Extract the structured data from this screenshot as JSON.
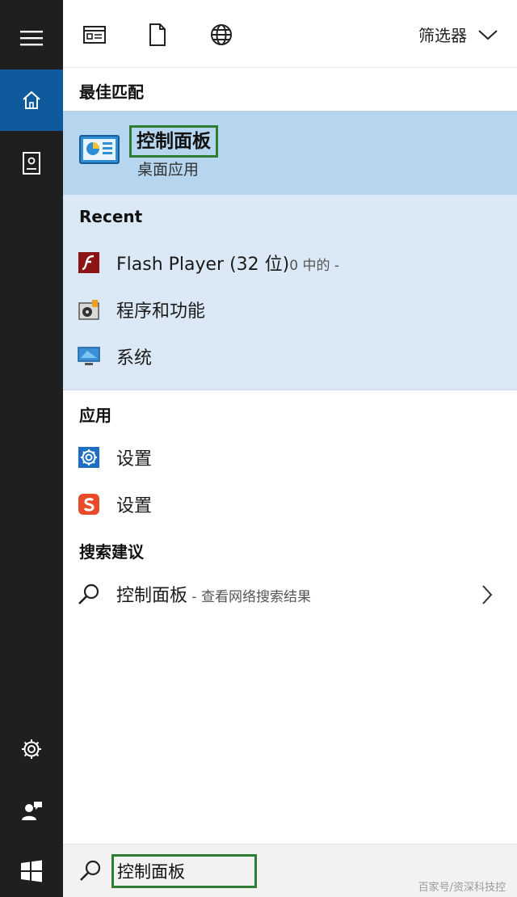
{
  "toolbar": {
    "filter_label": "筛选器"
  },
  "sections": {
    "best_match": "最佳匹配",
    "recent": "Recent",
    "apps": "应用",
    "suggestions": "搜索建议"
  },
  "best_match": {
    "title": "控制面板",
    "subtitle": "桌面应用"
  },
  "recent": [
    {
      "label": "Flash Player (32 位)",
      "detail": "0 中的 -"
    },
    {
      "label": "程序和功能",
      "detail": ""
    },
    {
      "label": "系统",
      "detail": ""
    }
  ],
  "apps": [
    {
      "label": "设置"
    },
    {
      "label": "设置"
    }
  ],
  "suggestion": {
    "label": "控制面板",
    "detail": " - 查看网络搜索结果"
  },
  "search": {
    "value": "控制面板"
  },
  "watermark": "百家号/资深科技控",
  "colors": {
    "rail": "#1f1f1f",
    "rail_active": "#0f5a9c",
    "best_match_bg": "#b6d5ee",
    "recent_bg": "#dbe9f6",
    "highlight_border": "#2e7d32"
  }
}
